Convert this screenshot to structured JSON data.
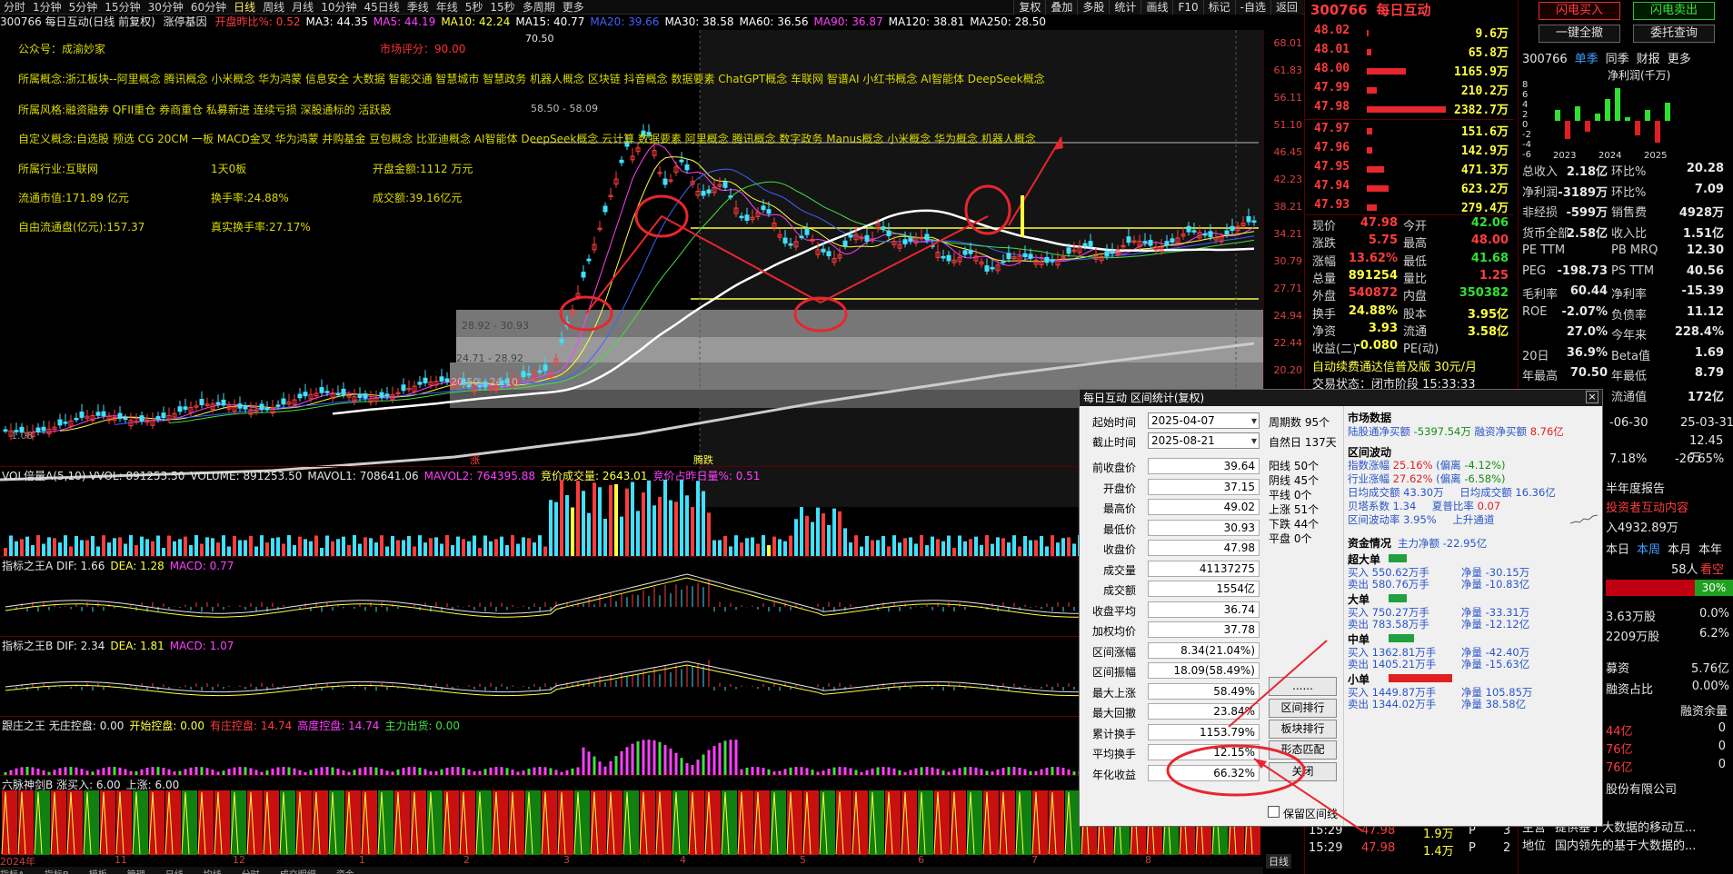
{
  "toolbar": {
    "periods": [
      "分时",
      "1分钟",
      "5分钟",
      "15分钟",
      "30分钟",
      "60分钟",
      "日线",
      "周线",
      "月线",
      "10分钟",
      "45日线",
      "季线",
      "年线",
      "5秒",
      "15秒",
      "多周期",
      "更多"
    ],
    "active": "日线",
    "right_tools": [
      "复权",
      "叠加",
      "多股",
      "统计",
      "画线",
      "F10",
      "标记",
      "-自选",
      "返回"
    ]
  },
  "ma_legend": {
    "title": "300766 每日互动(日线 前复权)",
    "basis": "涨停基因",
    "items": [
      {
        "t": "开盘昨比%: 0.52",
        "c": "#ff3c3c"
      },
      {
        "t": "MA3: 44.35",
        "c": "#ffffff"
      },
      {
        "t": "MA5: 44.19",
        "c": "#ff40ff"
      },
      {
        "t": "MA10: 42.24",
        "c": "#ffff40"
      },
      {
        "t": "MA15: 40.77",
        "c": "#ffffff"
      },
      {
        "t": "MA20: 39.66",
        "c": "#4060ff"
      },
      {
        "t": "MA30: 38.58",
        "c": "#ffffff"
      },
      {
        "t": "MA60: 36.56",
        "c": "#ffffff"
      },
      {
        "t": "MA90: 36.87",
        "c": "#ff40ff"
      },
      {
        "t": "MA120: 38.81",
        "c": "#ffffff"
      },
      {
        "t": "MA250: 28.50",
        "c": "#ffffff"
      }
    ]
  },
  "overlay": {
    "public": "公众号：",
    "public_val": "成渝妙家",
    "market_score": "市场评分：",
    "market_score_val": "90.00",
    "concept": "所属概念:浙江板块--阿里概念 腾讯概念 小米概念 华为鸿蒙 信息安全 大数据 智能交通 智慧城市 智慧政务 机器人概念 区块链 抖音概念 数据要素 ChatGPT概念 车联网 智谱AI 小红书概念 AI智能体 DeepSeek概念",
    "style": "所属风格:融资融券 QFII重仓 券商重仓 私募新进 连续亏损 深股通标的 活跃股",
    "custom": "自定义概念:自选股 预选 CG 20CM 一板 MACD金叉 华为鸿蒙 并购基金 豆包概念 比亚迪概念 AI智能体 DeepSeek概念 云计算 数据要素 阿里概念 腾讯概念 数字政务 Manus概念 小米概念 华为概念 机器人概念",
    "industry": "所属行业:互联网",
    "board": "1天0板",
    "open_amount": "开盘金额:1112 万元",
    "cap": "流通市值:171.89 亿元",
    "turnover": "换手率:24.88%",
    "amount": "成交额:39.16亿元",
    "free_cap": "自由流通盘(亿元):157.37",
    "real_turnover": "真实换手率:27.17%",
    "price_labels": [
      "70.50",
      "58.50 - 58.09",
      "28.92 - 30.93",
      "24.71 - 28.92",
      "20.50 - 24.10",
      "1.08"
    ],
    "markers": [
      "涨",
      "腾跌"
    ]
  },
  "yaxis": [
    "68.01",
    "61.83",
    "56.11",
    "51.10",
    "46.45",
    "42.23",
    "38.21",
    "34.21",
    "30.79",
    "27.71",
    "24.94",
    "22.44",
    "20.20"
  ],
  "sub_axis_label": "日线",
  "panels": {
    "vol": {
      "label": "VOL倍量A(5,10)",
      "items": [
        {
          "t": "VVOL: 891253.50",
          "c": "#e6e6e6"
        },
        {
          "t": "VOLUME: 891253.50",
          "c": "#e6e6e6"
        },
        {
          "t": "MAVOL1: 708641.06",
          "c": "#e6e6e6"
        },
        {
          "t": "MAVOL2: 764395.88",
          "c": "#ff40ff"
        },
        {
          "t": "竞价成交量: 2643.01",
          "c": "#ffff40"
        },
        {
          "t": "竞价占昨日量%: 0.51",
          "c": "#ff40ff"
        }
      ]
    },
    "macdA": {
      "label": "指标之王A",
      "items": [
        {
          "t": "DIF: 1.66",
          "c": "#e6e6e6"
        },
        {
          "t": "DEA: 1.28",
          "c": "#ffff40"
        },
        {
          "t": "MACD: 0.77",
          "c": "#ff40ff"
        }
      ]
    },
    "macdB": {
      "label": "指标之王B",
      "items": [
        {
          "t": "DIF: 2.34",
          "c": "#e6e6e6"
        },
        {
          "t": "DEA: 1.81",
          "c": "#ffff40"
        },
        {
          "t": "MACD: 1.07",
          "c": "#ff40ff"
        }
      ]
    },
    "zhuang": {
      "label": "跟庄之王",
      "items": [
        {
          "t": "无庄控盘: 0.00",
          "c": "#e6e6e6"
        },
        {
          "t": "开始控盘: 0.00",
          "c": "#ffff40"
        },
        {
          "t": "有庄控盘: 14.74",
          "c": "#ff3c3c"
        },
        {
          "t": "高度控盘: 14.74",
          "c": "#ff40ff"
        },
        {
          "t": "主力出货: 0.00",
          "c": "#40e040"
        }
      ]
    },
    "liumai": {
      "label": "六脉神剑B",
      "items": [
        {
          "t": "涨买入: 6.00",
          "c": "#e6e6e6"
        },
        {
          "t": "上涨: 6.00",
          "c": "#e6e6e6"
        }
      ]
    }
  },
  "time_axis": [
    "2024年",
    "11",
    "12",
    "1",
    "2",
    "3",
    "4",
    "5",
    "6",
    "7",
    "8"
  ],
  "right": {
    "code": "300766",
    "name": "每日互动",
    "asks": [
      {
        "p": "48.02",
        "v": "9.6万",
        "w": 0.02
      },
      {
        "p": "48.01",
        "v": "65.8万",
        "w": 0.05
      },
      {
        "p": "48.00",
        "v": "1165.9万",
        "w": 0.45
      },
      {
        "p": "47.99",
        "v": "210.2万",
        "w": 0.12
      },
      {
        "p": "47.98",
        "v": "2382.7万",
        "w": 0.92
      }
    ],
    "bids": [
      {
        "p": "47.97",
        "v": "151.6万",
        "w": 0.06
      },
      {
        "p": "47.96",
        "v": "142.9万",
        "w": 0.06
      },
      {
        "p": "47.95",
        "v": "471.3万",
        "w": 0.2
      },
      {
        "p": "47.94",
        "v": "623.2万",
        "w": 0.25
      },
      {
        "p": "47.93",
        "v": "279.4万",
        "w": 0.12
      }
    ],
    "quote": [
      {
        "a": "现价",
        "av": "47.98",
        "ac": "red",
        "b": "今开",
        "bv": "42.06",
        "bc": "grn"
      },
      {
        "a": "涨跌",
        "av": "5.75",
        "ac": "red",
        "b": "最高",
        "bv": "48.00",
        "bc": "red"
      },
      {
        "a": "涨幅",
        "av": "13.62%",
        "ac": "red",
        "b": "最低",
        "bv": "41.68",
        "bc": "grn"
      },
      {
        "a": "总量",
        "av": "891254",
        "ac": "yel",
        "b": "量比",
        "bv": "1.25",
        "bc": "red"
      },
      {
        "a": "外盘",
        "av": "540872",
        "ac": "red",
        "b": "内盘",
        "bv": "350382",
        "bc": "grn"
      },
      {
        "a": "换手",
        "av": "24.88%",
        "ac": "yel",
        "b": "股本",
        "bv": "3.95亿",
        "bc": "yel"
      },
      {
        "a": "净资",
        "av": "3.93",
        "ac": "yel",
        "b": "流通",
        "bv": "3.58亿",
        "bc": "yel"
      },
      {
        "a": "收益(二)",
        "av": "-0.080",
        "ac": "yel",
        "b": "PE(动)",
        "bv": "",
        "bc": "yel"
      }
    ],
    "ticker": "自动续费通达信普及版 30元/月",
    "status": "交易状态：闭市阶段 15:33:33",
    "trades": [
      {
        "t": "15:29",
        "p": "47.98",
        "v": "1.9万",
        "d": "P",
        "n": "3"
      },
      {
        "t": "15:29",
        "p": "47.98",
        "v": "1.4万",
        "d": "P",
        "n": "2"
      }
    ],
    "side_buttons": {
      "flash_buy": "闪电买入",
      "flash_sell": "闪电卖出",
      "one_click": "一键全撤",
      "order_query": "委托查询"
    },
    "fin_tabs": [
      "300766",
      "单季",
      "同季",
      "财报",
      "更多"
    ],
    "fin_chart_title": "净利润(千万)",
    "fin_yaxis": [
      "8",
      "6",
      "4",
      "2",
      "0",
      "-2",
      "-4",
      "-6"
    ],
    "fin_xaxis": [
      "2023",
      "2024",
      "2025"
    ],
    "fin": [
      {
        "a": "总收入",
        "av": "2.18亿",
        "b": "环比%",
        "bv": "20.28"
      },
      {
        "a": "净利润",
        "av": "-3189万",
        "b": "环比%",
        "bv": "7.09"
      },
      {
        "a": "非经损",
        "av": "-599万",
        "b": "销售费",
        "bv": "4928万"
      },
      {
        "a": "货币全部",
        "av": "2.58亿",
        "b": "收入比",
        "bv": "1.51亿"
      },
      {
        "a": "PE TTM",
        "av": "",
        "b": "PB MRQ",
        "bv": "12.30"
      },
      {
        "a": "PEG",
        "av": "-198.73",
        "b": "PS TTM",
        "bv": "40.56"
      },
      {
        "a": "毛利率",
        "av": "60.44",
        "b": "净利率",
        "bv": "-15.39"
      },
      {
        "a": "ROE",
        "av": "-2.07%",
        "b": "负债率",
        "bv": "11.12"
      },
      {
        "a": "",
        "av": "27.0%",
        "b": "今年来",
        "bv": "228.4%"
      },
      {
        "a": "20日",
        "av": "36.9%",
        "b": "Beta值",
        "bv": "1.69"
      },
      {
        "a": "年最高",
        "av": "70.50",
        "b": "年最低",
        "bv": "8.79"
      },
      {
        "a": "",
        "av": "",
        "b": "流通值",
        "bv": "172亿"
      }
    ],
    "dates": {
      "d1": "-06-30",
      "d2": "25-03-31",
      "v1": "",
      "v2": "12.45万",
      "p1": "7.18%",
      "p2": "-26.65%"
    },
    "report": "半年度报告",
    "investor": "投资者互动内容",
    "cashflow": "入4932.89万",
    "tabs2": [
      "本日",
      "本周",
      "本月",
      "本年"
    ],
    "holder_count": "58人",
    "holder_btn": "看空",
    "pct30": "30%",
    "rows3": [
      {
        "a": "3.63万股",
        "b": "0.0%"
      },
      {
        "a": "2209万股",
        "b": "6.2%"
      }
    ],
    "margin": {
      "a": "募资",
      "av": "5.76亿",
      "b": "",
      "bv": "融资占比",
      "c": "0.00%",
      "d": "融资余量"
    },
    "margin_vals": [
      {
        "a": "44亿",
        "b": "0"
      },
      {
        "a": "76亿",
        "b": "0"
      },
      {
        "a": "76亿",
        "b": "0"
      }
    ],
    "company": "股份有限公司",
    "biz": [
      {
        "k": "主营",
        "v": "提供基于大数据的移动互..."
      },
      {
        "k": "地位",
        "v": "国内领先的基于大数据的..."
      }
    ]
  },
  "dialog": {
    "title": "每日互动 区间统计(复权)",
    "start_label": "起始时间",
    "start": "2025-04-07",
    "end_label": "截止时间",
    "end": "2025-08-21",
    "period_count": "周期数 95个",
    "natural_days": "自然日 137天",
    "rows": [
      {
        "l": "前收盘价",
        "v": "39.64"
      },
      {
        "l": "开盘价",
        "v": "37.15"
      },
      {
        "l": "最高价",
        "v": "49.02"
      },
      {
        "l": "最低价",
        "v": "30.93"
      },
      {
        "l": "收盘价",
        "v": "47.98"
      },
      {
        "l": "成交量",
        "v": "41137275"
      },
      {
        "l": "成交额",
        "v": "1554亿"
      },
      {
        "l": "收盘平均",
        "v": "36.74"
      },
      {
        "l": "加权均价",
        "v": "37.78"
      },
      {
        "l": "区间涨幅",
        "v": "8.34(21.04%)"
      },
      {
        "l": "区间振幅",
        "v": "18.09(58.49%)"
      },
      {
        "l": "最大上涨",
        "v": "58.49%"
      },
      {
        "l": "最大回撤",
        "v": "23.84%"
      },
      {
        "l": "累计换手",
        "v": "1153.79%"
      },
      {
        "l": "平均换手",
        "v": "12.15%"
      },
      {
        "l": "年化收益",
        "v": "66.32%"
      }
    ],
    "counts": [
      "阳线 50个",
      "阴线 45个",
      "平线 0个",
      "上涨 51个",
      "下跌 44个",
      "平盘 0个"
    ],
    "buttons": [
      "......",
      "区间排行",
      "板块排行",
      "形态匹配",
      "关闭"
    ],
    "keep": "保留区间线",
    "market_head": "市场数据",
    "market_line": {
      "a": "陆股通净买额",
      "av": "-5397.54万",
      "b": "融资净买额",
      "bv": "8.76亿"
    },
    "wave_head": "区间波动",
    "wave": [
      {
        "a": "指数涨幅",
        "av": "25.16%",
        "b": "(偏离",
        "bv": "-4.12%)"
      },
      {
        "a": "行业涨幅",
        "av": "27.62%",
        "b": "(偏离",
        "bv": "-6.58%)"
      },
      {
        "a": "日均成交额",
        "av": "43.30万",
        "b": "日均成交额",
        "bv": "16.36亿"
      },
      {
        "a": "贝塔系数",
        "av": "1.34",
        "b": "夏普比率",
        "bv": "0.07"
      },
      {
        "a": "区间波动率",
        "av": "3.95%",
        "b": "上升通道",
        "bv": ""
      }
    ],
    "fund_head": "资金情况",
    "fund_main": "主力净额 -22.95亿",
    "groups": [
      {
        "name": "超大单",
        "buy": "买入 550.62万手",
        "net": "净量 -30.15万",
        "sell": "卖出 580.76万手",
        "net2": "净量 -10.83亿",
        "c": "#20a040",
        "w": 20
      },
      {
        "name": "大单",
        "buy": "买入 750.27万手",
        "net": "净量 -33.31万",
        "sell": "卖出 783.58万手",
        "net2": "净量 -12.12亿",
        "c": "#20a040",
        "w": 20
      },
      {
        "name": "中单",
        "buy": "买入 1362.81万手",
        "net": "净量 -42.40万",
        "sell": "卖出 1405.21万手",
        "net2": "净量 -15.63亿",
        "c": "#20a040",
        "w": 28
      },
      {
        "name": "小单",
        "buy": "买入 1449.87万手",
        "net": "净量 105.85万",
        "sell": "卖出 1344.02万手",
        "net2": "净量 38.58亿",
        "c": "#e02020",
        "w": 70
      }
    ]
  }
}
